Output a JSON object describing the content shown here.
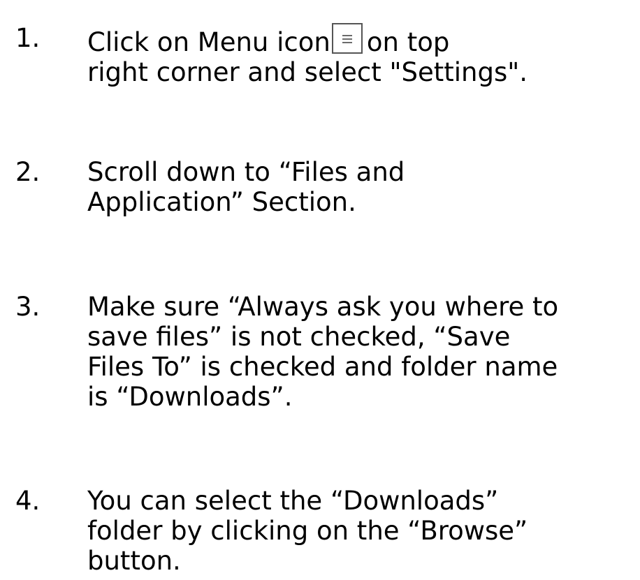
{
  "steps": [
    {
      "number": "1.",
      "lines": [
        "Click on Menu icon",
        "on  top",
        "right corner and select \"Settings\"."
      ],
      "icon": "menu-icon"
    },
    {
      "number": "2.",
      "lines": [
        "Scroll down to “Files and",
        "Application” Section."
      ]
    },
    {
      "number": "3.",
      "lines": [
        "Make sure “Always ask you where to",
        "save files” is not checked, “Save",
        "Files To” is checked and folder name",
        "is “Downloads”."
      ]
    },
    {
      "number": "4.",
      "lines": [
        "You can select the “Downloads”",
        "folder by clicking on the “Browse”",
        "button."
      ]
    }
  ]
}
